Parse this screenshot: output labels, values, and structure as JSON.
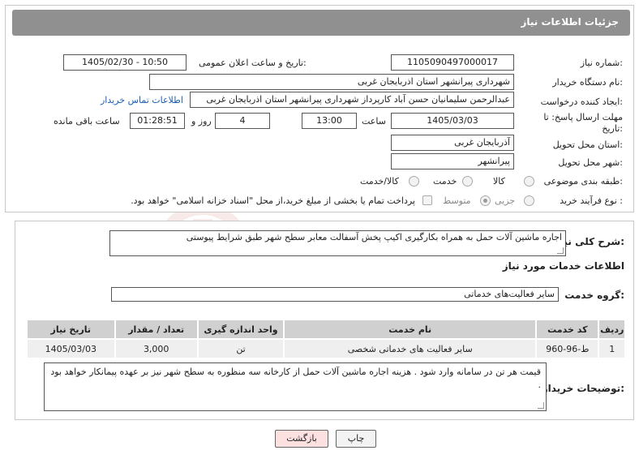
{
  "header": {
    "title": "جزئیات اطلاعات نیاز"
  },
  "fields": {
    "need_number_label": "شماره نیاز:",
    "need_number": "1105090497000017",
    "announce_label": "تاریخ و ساعت اعلان عمومی:",
    "announce_value": "1405/02/30 - 10:50",
    "buyer_org_label": "نام دستگاه خریدار:",
    "buyer_org": "شهرداری پیرانشهر استان اذربایجان غربی",
    "requester_label": "ایجاد کننده درخواست:",
    "requester": "عبدالرحمن سلیمانیان حسن آباد کارپرداز شهرداری پیرانشهر استان اذربایجان غربی",
    "contact_link": "اطلاعات تماس خریدار",
    "deadline_label_1": "مهلت ارسال پاسخ: تا",
    "deadline_label_2": "تاریخ:",
    "deadline_date": "1405/03/03",
    "time_label": "ساعت",
    "deadline_time": "13:00",
    "days_value": "4",
    "days_label": "روز و",
    "remaining_time": "01:28:51",
    "remaining_label": "ساعت باقی مانده",
    "province_label": "استان محل تحویل:",
    "province": "آذربایجان غربی",
    "city_label": "شهر محل تحویل:",
    "city": "پیرانشهر",
    "category_label": "طبقه بندی موضوعی:",
    "category_options": [
      "کالا",
      "خدمت",
      "کالا/خدمت"
    ],
    "process_label": "نوع فرآیند خرید :",
    "process_options": [
      "جزیی",
      "متوسط"
    ],
    "payment_text": "پرداخت تمام یا بخشی از مبلغ خرید،از محل \"اسناد خزانه اسلامی\" خواهد بود."
  },
  "description": {
    "label": "شرح کلی نیاز:",
    "text": "اجاره ماشین آلات حمل به همراه بکارگیری اکیپ پخش آسفالت معابر سطح شهر طبق شرایط پیوستی"
  },
  "services": {
    "title": "اطلاعات خدمات مورد نیاز",
    "group_label": "گروه خدمت:",
    "group_value": "سایر فعالیت‌های خدماتی",
    "columns": [
      "ردیف",
      "کد خدمت",
      "نام خدمت",
      "واحد اندازه گیری",
      "تعداد / مقدار",
      "تاریخ نیاز"
    ],
    "rows": [
      [
        "1",
        "ط-96-960",
        "سایر فعالیت های خدماتی شخصی",
        "تن",
        "3,000",
        "1405/03/03"
      ]
    ]
  },
  "buyer_notes": {
    "label": "توضیحات خریدار:",
    "text": "قیمت هر تن در سامانه وارد شود . هزینه اجاره ماشین آلات حمل از کارخانه سه منظوره به سطح شهر نیز بر عهده پیمانکار خواهد بود ."
  },
  "buttons": {
    "print": "چاپ",
    "back": "بازگشت"
  },
  "watermark": {
    "text": "AriaTender.neT"
  }
}
